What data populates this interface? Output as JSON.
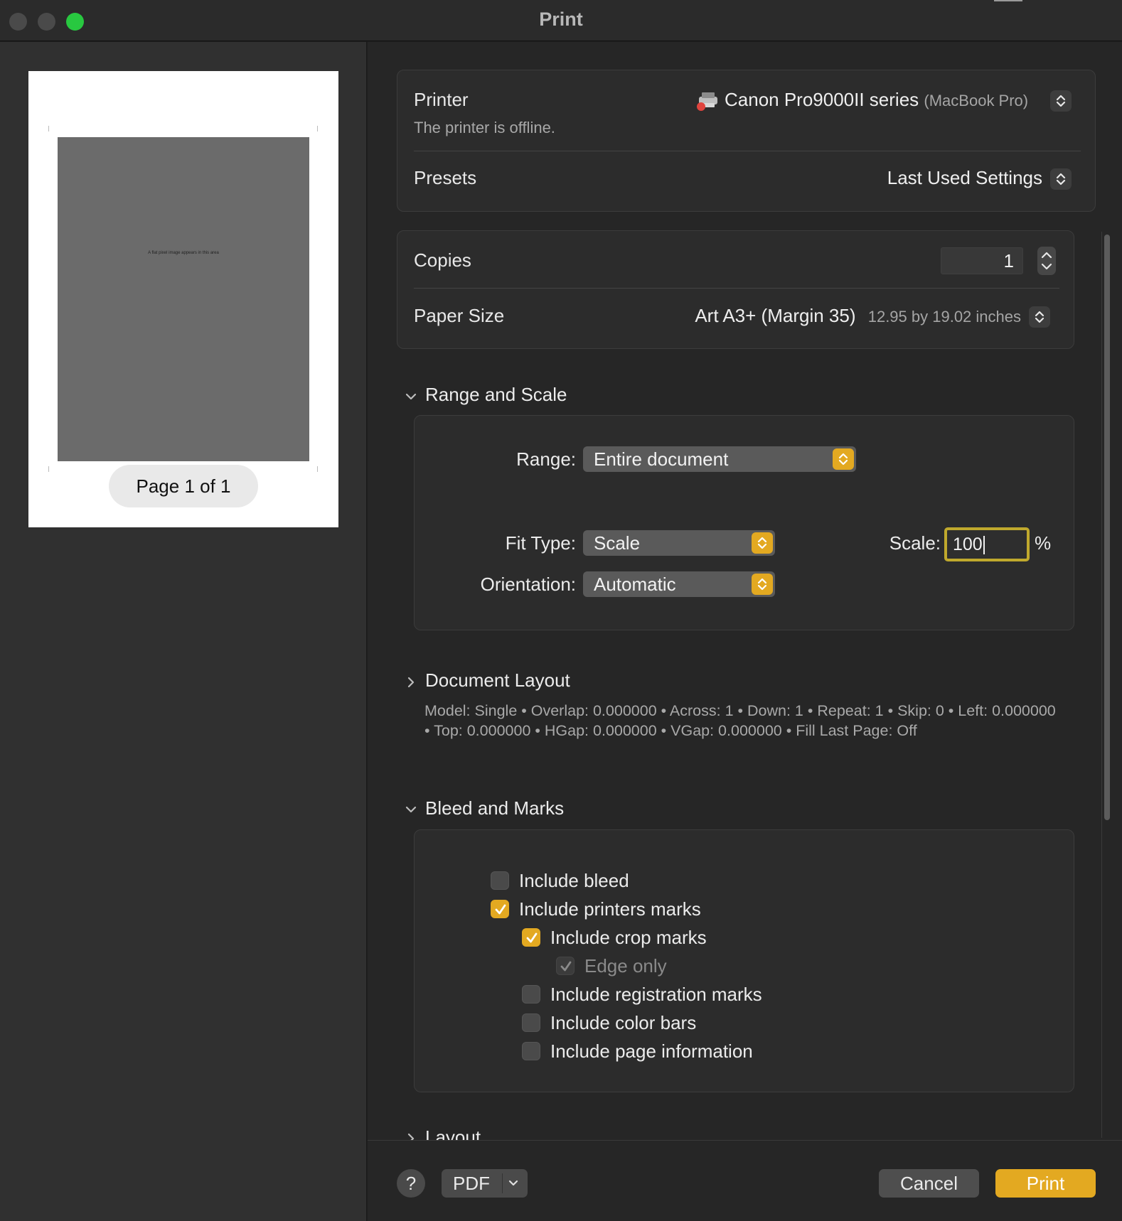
{
  "window": {
    "title": "Print"
  },
  "preview": {
    "caption": "A flat pixel image appears in this area",
    "page_indicator": "Page 1 of 1"
  },
  "printer": {
    "label": "Printer",
    "name": "Canon Pro9000II series",
    "host": "(MacBook Pro)",
    "status": "The printer is offline.",
    "icon": "printer-icon"
  },
  "presets": {
    "label": "Presets",
    "value": "Last Used Settings"
  },
  "copies": {
    "label": "Copies",
    "value": "1"
  },
  "paper_size": {
    "label": "Paper Size",
    "value": "Art A3+ (Margin 35)",
    "dimensions": "12.95 by 19.02 inches"
  },
  "range_and_scale": {
    "header": "Range and Scale",
    "range_label": "Range:",
    "range_value": "Entire document",
    "fit_type_label": "Fit Type:",
    "fit_type_value": "Scale",
    "orientation_label": "Orientation:",
    "orientation_value": "Automatic",
    "scale_label": "Scale:",
    "scale_value": "100",
    "scale_unit": "%"
  },
  "document_layout": {
    "header": "Document Layout",
    "summary": "Model: Single • Overlap: 0.000000 • Across: 1 • Down: 1 • Repeat: 1 • Skip: 0 • Left: 0.000000 • Top: 0.000000 • HGap: 0.000000 • VGap: 0.000000 • Fill Last Page: Off"
  },
  "bleed_and_marks": {
    "header": "Bleed and Marks",
    "options": [
      {
        "label": "Include bleed",
        "checked": false
      },
      {
        "label": "Include printers marks",
        "checked": true
      },
      {
        "label": "Include crop marks",
        "checked": true
      },
      {
        "label": "Edge only",
        "checked": true,
        "disabled": true
      },
      {
        "label": "Include registration marks",
        "checked": false
      },
      {
        "label": "Include color bars",
        "checked": false
      },
      {
        "label": "Include page information",
        "checked": false
      }
    ]
  },
  "layout": {
    "header": "Layout"
  },
  "footer": {
    "help": "?",
    "pdf": "PDF",
    "cancel": "Cancel",
    "print": "Print"
  },
  "colors": {
    "accent": "#e3a921",
    "zoom": "#28c840",
    "offline_dot": "#e0443e"
  }
}
